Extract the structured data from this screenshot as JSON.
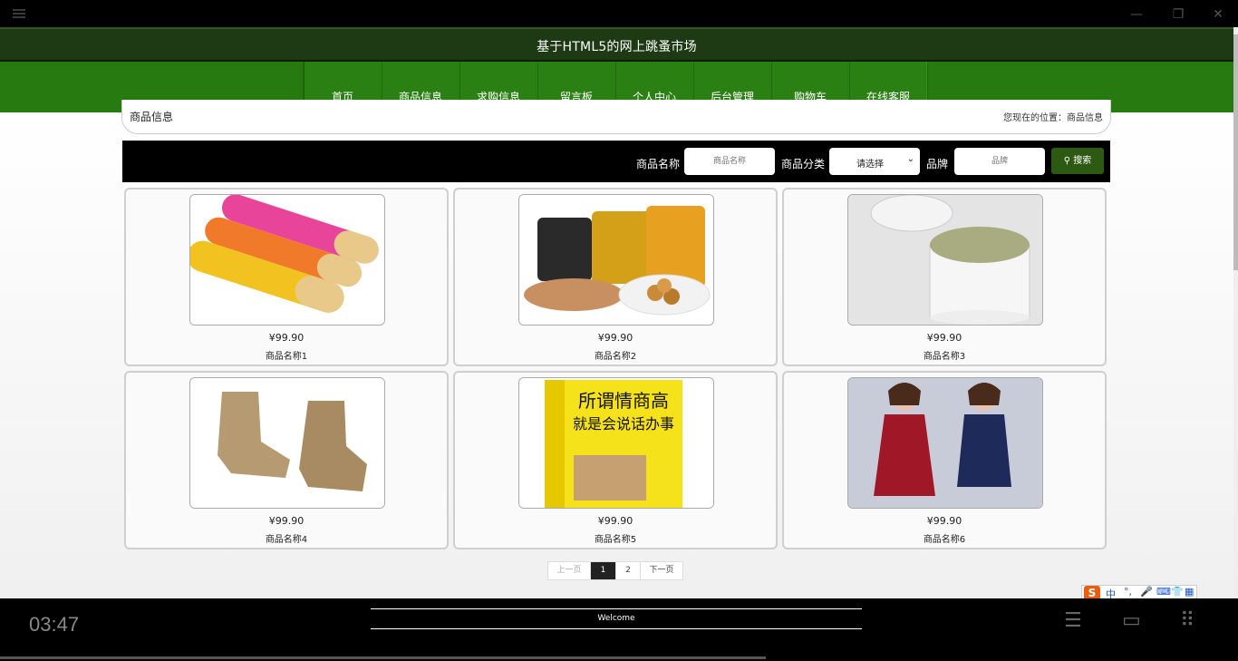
{
  "player": {
    "time": "03:47"
  },
  "site": {
    "title": "基于HTML5的网上跳蚤市场",
    "nav": [
      "首页",
      "商品信息",
      "求购信息",
      "留言板",
      "个人中心",
      "后台管理",
      "购物车",
      "在线客服"
    ]
  },
  "breadcrumb": {
    "title": "商品信息",
    "location": "您现在的位置：商品信息"
  },
  "search": {
    "name_label": "商品名称",
    "name_placeholder": "商品名称",
    "category_label": "商品分类",
    "category_selected": "请选择",
    "brand_label": "品牌",
    "brand_placeholder": "品牌",
    "button_label": "搜索"
  },
  "products": [
    {
      "price": "¥99.90",
      "name": "商品名称1"
    },
    {
      "price": "¥99.90",
      "name": "商品名称2"
    },
    {
      "price": "¥99.90",
      "name": "商品名称3"
    },
    {
      "price": "¥99.90",
      "name": "商品名称4"
    },
    {
      "price": "¥99.90",
      "name": "商品名称5"
    },
    {
      "price": "¥99.90",
      "name": "商品名称6"
    }
  ],
  "book_cover": {
    "title_line1": "所谓情商高",
    "title_line2": "就是会说话办事"
  },
  "pager": {
    "prev": "上一页",
    "pages": [
      "1",
      "2"
    ],
    "next": "下一页"
  },
  "footer": {
    "welcome": "Welcome"
  },
  "ime": {
    "lang": "中"
  },
  "colors": {
    "header_bg": "#1e3a14",
    "nav_bg": "#267a10",
    "search_btn": "#2c5a13"
  }
}
